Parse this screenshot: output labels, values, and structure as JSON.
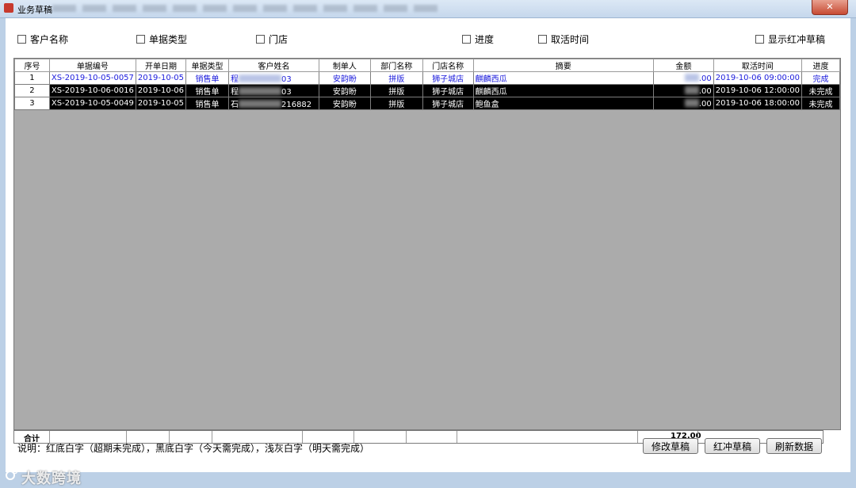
{
  "window": {
    "title": "业务草稿",
    "close_glyph": "✕"
  },
  "filters": [
    {
      "label": "客户名称",
      "checked": false
    },
    {
      "label": "单据类型",
      "checked": false
    },
    {
      "label": "门店",
      "checked": false
    },
    {
      "label": "进度",
      "checked": false
    },
    {
      "label": "取活时间",
      "checked": false
    },
    {
      "label": "显示红冲草稿",
      "checked": false
    }
  ],
  "grid": {
    "columns": [
      "序号",
      "单据编号",
      "开单日期",
      "单据类型",
      "客户姓名",
      "制单人",
      "部门名称",
      "门店名称",
      "摘要",
      "金额",
      "取活时间",
      "进度"
    ],
    "rows": [
      {
        "style": "white",
        "cells": [
          "1",
          "XS-2019-10-05-0057",
          "2019-10-05",
          "销售单",
          "程",
          "03",
          "安韵盼",
          "拼版",
          "狮子城店",
          "麒麟西瓜",
          ".00",
          "2019-10-06 09:00:00",
          "完成"
        ]
      },
      {
        "style": "black",
        "cells": [
          "2",
          "XS-2019-10-06-0016",
          "2019-10-06",
          "销售单",
          "程",
          "03",
          "安韵盼",
          "拼版",
          "狮子城店",
          "麒麟西瓜",
          ".00",
          "2019-10-06 12:00:00",
          "未完成"
        ]
      },
      {
        "style": "black",
        "cells": [
          "3",
          "XS-2019-10-05-0049",
          "2019-10-05",
          "销售单",
          "石",
          "216882",
          "安韵盼",
          "拼版",
          "狮子城店",
          "鲍鱼盒",
          ".00",
          "2019-10-06 18:00:00",
          "未完成"
        ]
      }
    ]
  },
  "totals": {
    "label": "合计",
    "amount": "172.00"
  },
  "footer": {
    "note": "说明：红底白字（超期未完成），黑底白字（今天需完成），浅灰白字（明天需完成）",
    "buttons": {
      "edit": "修改草稿",
      "reverse": "红冲草稿",
      "refresh": "刷新数据"
    }
  },
  "watermark": "大数跨境"
}
